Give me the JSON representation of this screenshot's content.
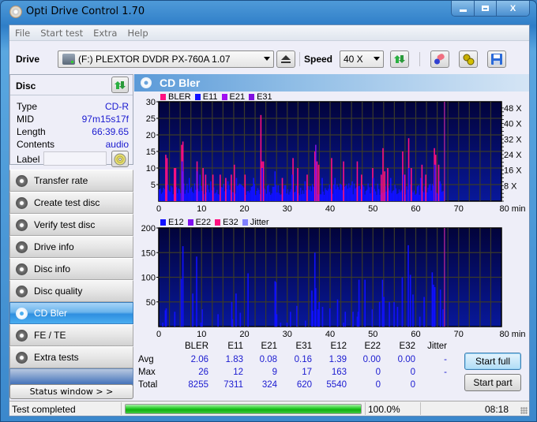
{
  "window": {
    "title": "Opti Drive Control 1.70",
    "controls": {
      "minimize": "—",
      "maximize": "□",
      "close": "X"
    }
  },
  "menu": [
    "File",
    "Start test",
    "Extra",
    "Help"
  ],
  "toolbar": {
    "drive_label": "Drive",
    "drive_value": "(F:)  PLEXTOR DVDR   PX-760A 1.07",
    "speed_label": "Speed",
    "speed_value": "40 X",
    "icons": [
      "eject-icon",
      "refresh-icon",
      "eraser-icon",
      "settings-icon",
      "save-icon"
    ]
  },
  "disc": {
    "title": "Disc",
    "rows": [
      {
        "key": "Type",
        "value": "CD-R"
      },
      {
        "key": "MID",
        "value": "97m15s17f"
      },
      {
        "key": "Length",
        "value": "66:39.65"
      },
      {
        "key": "Contents",
        "value": "audio"
      }
    ],
    "label_key": "Label",
    "label_value": ""
  },
  "nav": [
    {
      "label": "Transfer rate",
      "active": false
    },
    {
      "label": "Create test disc",
      "active": false
    },
    {
      "label": "Verify test disc",
      "active": false
    },
    {
      "label": "Drive info",
      "active": false
    },
    {
      "label": "Disc info",
      "active": false
    },
    {
      "label": "Disc quality",
      "active": false
    },
    {
      "label": "CD Bler",
      "active": true
    },
    {
      "label": "FE / TE",
      "active": false
    },
    {
      "label": "Extra tests",
      "active": false
    }
  ],
  "status_window_button": "Status window > >",
  "main": {
    "title": "CD Bler"
  },
  "chart_data": [
    {
      "type": "bar",
      "title": "",
      "legend": [
        "BLER",
        "E11",
        "E21",
        "E31"
      ],
      "legend_colors": [
        "#ff1080",
        "#1010ff",
        "#a010f0",
        "#8010e0"
      ],
      "legend_placement": "top-left",
      "xlabel": "min",
      "xlim": [
        0,
        80
      ],
      "x_ticks": [
        "0",
        "10",
        "20",
        "30",
        "40",
        "50",
        "60",
        "70",
        "80 min"
      ],
      "ylim": [
        0,
        30
      ],
      "y_ticks": [
        "5",
        "10",
        "15",
        "20",
        "25",
        "30"
      ],
      "y2_ticks": [
        "8 X",
        "16 X",
        "24 X",
        "32 X",
        "40 X",
        "48 X"
      ],
      "disc_end_min": 66.7,
      "grid": true,
      "series": [
        {
          "name": "BLER",
          "peaks": [
            [
              1.5,
              14
            ],
            [
              1.8,
              13
            ],
            [
              3.5,
              10
            ],
            [
              3.8,
              10
            ],
            [
              5.2,
              17
            ],
            [
              5.5,
              18
            ],
            [
              8.8,
              12
            ],
            [
              10.2,
              10
            ],
            [
              10.8,
              8
            ],
            [
              12.5,
              8
            ],
            [
              14.2,
              8
            ],
            [
              15.5,
              7
            ],
            [
              16.8,
              8
            ],
            [
              17.5,
              11
            ],
            [
              20,
              8
            ],
            [
              23.7,
              26
            ],
            [
              24,
              12
            ],
            [
              24.3,
              12
            ],
            [
              28.7,
              7
            ],
            [
              31.2,
              13
            ],
            [
              32.3,
              10
            ],
            [
              34.5,
              8
            ],
            [
              36.3,
              15
            ],
            [
              36.8,
              12
            ],
            [
              37.2,
              11
            ],
            [
              40.2,
              13
            ],
            [
              43,
              12
            ],
            [
              46.2,
              12
            ],
            [
              47.2,
              8
            ],
            [
              49.8,
              10
            ],
            [
              51.8,
              8
            ],
            [
              52.2,
              16
            ],
            [
              52.6,
              9
            ],
            [
              53.3,
              10
            ],
            [
              56.8,
              15
            ],
            [
              57.3,
              8
            ],
            [
              58.2,
              19
            ],
            [
              58.8,
              10
            ],
            [
              61.3,
              11
            ],
            [
              62.2,
              8
            ],
            [
              64.2,
              16
            ],
            [
              64.5,
              14
            ],
            [
              65.2,
              11
            ]
          ]
        },
        {
          "name": "E11",
          "peaks": [
            [
              1,
              4
            ],
            [
              2,
              5
            ],
            [
              5.3,
              12
            ],
            [
              7,
              7
            ],
            [
              9.5,
              8
            ],
            [
              12,
              6
            ],
            [
              16,
              6
            ],
            [
              18,
              7
            ],
            [
              22,
              7
            ],
            [
              24,
              10
            ],
            [
              27,
              9
            ],
            [
              31,
              8
            ],
            [
              34,
              6
            ],
            [
              36.5,
              11
            ],
            [
              38,
              7
            ],
            [
              41,
              7
            ],
            [
              45,
              6
            ],
            [
              50,
              7
            ],
            [
              54,
              7
            ],
            [
              57,
              8
            ],
            [
              58.3,
              10
            ],
            [
              61,
              7
            ],
            [
              64.3,
              11
            ],
            [
              65.5,
              6
            ]
          ],
          "baseline": 3
        },
        {
          "name": "E21",
          "peaks": [
            [
              5.5,
              9
            ],
            [
              8.8,
              9
            ]
          ]
        },
        {
          "name": "E31",
          "peaks": [
            [
              36.5,
              17
            ]
          ]
        }
      ]
    },
    {
      "type": "bar",
      "title": "",
      "legend": [
        "E12",
        "E22",
        "E32",
        "Jitter"
      ],
      "legend_colors": [
        "#1010ff",
        "#8010f0",
        "#ff1080",
        "#8080ff"
      ],
      "legend_placement": "top-left",
      "xlabel": "min",
      "xlim": [
        0,
        80
      ],
      "x_ticks": [
        "0",
        "10",
        "20",
        "30",
        "40",
        "50",
        "60",
        "70",
        "80 min"
      ],
      "ylim": [
        0,
        200
      ],
      "y_ticks": [
        "50",
        "100",
        "150",
        "200"
      ],
      "disc_end_min": 66.7,
      "grid": true,
      "series": [
        {
          "name": "E12",
          "peaks": [
            [
              0.8,
              8
            ],
            [
              1.4,
              33
            ],
            [
              1.6,
              37
            ],
            [
              3.6,
              30
            ],
            [
              5.1,
              97
            ],
            [
              5.5,
              163
            ],
            [
              7.8,
              67
            ],
            [
              8.7,
              142
            ],
            [
              9.7,
              8
            ],
            [
              10,
              35
            ],
            [
              13.7,
              25
            ],
            [
              16.9,
              50
            ],
            [
              17.1,
              15
            ],
            [
              17.9,
              67
            ],
            [
              18.9,
              28
            ],
            [
              20.7,
              108
            ],
            [
              27,
              92
            ],
            [
              27.2,
              90
            ],
            [
              27.4,
              25
            ],
            [
              28.3,
              8
            ],
            [
              29.8,
              8
            ],
            [
              30.6,
              30
            ],
            [
              32.1,
              42
            ],
            [
              34.1,
              12
            ],
            [
              35.6,
              73
            ],
            [
              35.8,
              32
            ],
            [
              36.3,
              150
            ],
            [
              36.5,
              78
            ],
            [
              37,
              35
            ],
            [
              37.3,
              50
            ],
            [
              38.1,
              40
            ],
            [
              39.8,
              37
            ],
            [
              41.6,
              55
            ],
            [
              43,
              8
            ],
            [
              43.4,
              30
            ],
            [
              45.2,
              30
            ],
            [
              46.2,
              20
            ],
            [
              46.4,
              30
            ],
            [
              46.6,
              95
            ],
            [
              48,
              95
            ],
            [
              49.7,
              35
            ],
            [
              51.4,
              50
            ],
            [
              52.1,
              95
            ],
            [
              52.4,
              60
            ],
            [
              53.7,
              50
            ],
            [
              54.8,
              50
            ],
            [
              55.6,
              40
            ],
            [
              56.7,
              100
            ],
            [
              58.1,
              165
            ],
            [
              58.6,
              105
            ],
            [
              59.2,
              65
            ],
            [
              60.8,
              20
            ],
            [
              61.8,
              60
            ],
            [
              63.7,
              110
            ],
            [
              64,
              85
            ],
            [
              64.3,
              80
            ],
            [
              65.6,
              75
            ],
            [
              66.2,
              35
            ]
          ]
        },
        {
          "name": "E22",
          "peaks": []
        },
        {
          "name": "E32",
          "peaks": []
        },
        {
          "name": "Jitter",
          "peaks": []
        }
      ]
    }
  ],
  "stats": {
    "columns": [
      "BLER",
      "E11",
      "E21",
      "E31",
      "E12",
      "E22",
      "E32",
      "Jitter"
    ],
    "rows": [
      {
        "label": "Avg",
        "values": [
          "2.06",
          "1.83",
          "0.08",
          "0.16",
          "1.39",
          "0.00",
          "0.00",
          "-"
        ]
      },
      {
        "label": "Max",
        "values": [
          "26",
          "12",
          "9",
          "17",
          "163",
          "0",
          "0",
          "-"
        ]
      },
      {
        "label": "Total",
        "values": [
          "8255",
          "7311",
          "324",
          "620",
          "5540",
          "0",
          "0",
          ""
        ]
      }
    ]
  },
  "buttons": {
    "start_full": "Start full",
    "start_part": "Start part"
  },
  "statusbar": {
    "text": "Test completed",
    "progress": 1.0,
    "progress_text": "100.0%",
    "time": "08:18"
  }
}
